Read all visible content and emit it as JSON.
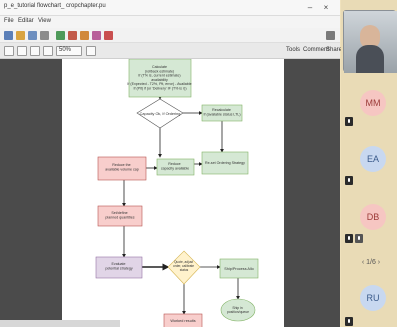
{
  "viewer": {
    "title": "p_e_tutorial flowchart_ cropchapter.pu",
    "menu": [
      "File",
      "Editar",
      "View"
    ],
    "zoom": "50%",
    "right_tools": [
      "Tools",
      "Comment",
      "Share"
    ]
  },
  "flowchart": {
    "top_box": "Calculate\n(rollback estimate)\nIf (T% is, current estimate)\navailability\nIf (Expected - T2%, Plt, error) - Available\nIf (Plt) if (or 'Delivery' IF (T% is r))",
    "decision1": "Capacity Ok, If Ordering",
    "right_box1": "Recalculate\nIf (available status LTL)",
    "left_box1": "Reduce the\navailable volume cap",
    "mid_box": "Reduce\ncapacity available",
    "right_box2": "Re-set Ordering Strategy",
    "left_box2": "Set/define\nplanned quantities",
    "left_box3": "Evaluate\npotential strategy",
    "decision2": "Quote, adjust\norder, calibrate\nstatus",
    "right_box3": "Ship/Process Allo",
    "end_oval": "Ship in\nposition/queue",
    "bottom_box": "Worked results"
  },
  "participants": [
    {
      "initials": "",
      "avatar_color": "#c9c9c9",
      "muted": false,
      "is_video": true
    },
    {
      "initials": "MM",
      "avatar_color": "#f6c6c2",
      "text_color": "#9b3a38",
      "muted": true
    },
    {
      "initials": "EA",
      "avatar_color": "#c8d8f0",
      "text_color": "#3a5a8a",
      "muted": true
    },
    {
      "initials": "DB",
      "avatar_color": "#f6c6c2",
      "text_color": "#9b3a38",
      "muted": true
    },
    {
      "initials": "RU",
      "avatar_color": "#c8d8f0",
      "text_color": "#3a5a8a",
      "muted": true
    }
  ],
  "pager": "1/6",
  "colors": {
    "green_box": "#d5e8d4",
    "green_border": "#82b366",
    "red_box": "#f8cecc",
    "red_border": "#b85450",
    "yellow_box": "#fff2cc",
    "yellow_border": "#d6b656",
    "purple_box": "#e1d5e7",
    "purple_border": "#9673a6",
    "canvas_bg": "#4b4b4b"
  }
}
